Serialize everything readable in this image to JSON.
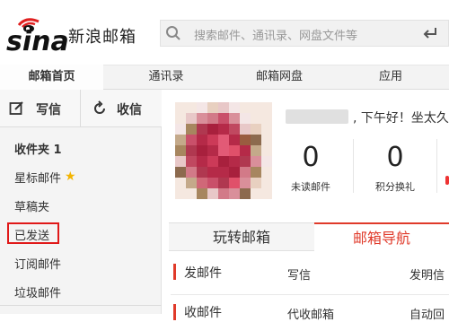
{
  "brand": {
    "logo_text": "sina",
    "name": "新浪邮箱"
  },
  "search": {
    "placeholder": "搜索邮件、通讯录、网盘文件等"
  },
  "nav": {
    "tabs": [
      {
        "label": "邮箱首页",
        "active": true
      },
      {
        "label": "通讯录"
      },
      {
        "label": "邮箱网盘"
      },
      {
        "label": "应用"
      }
    ]
  },
  "sidebar": {
    "compose_label": "写信",
    "receive_label": "收信",
    "items": [
      {
        "label": "收件夹 1"
      },
      {
        "label": "星标邮件",
        "icon": "star-icon"
      },
      {
        "label": "草稿夹"
      },
      {
        "label": "已发送",
        "highlighted": true
      },
      {
        "label": "订阅邮件"
      },
      {
        "label": "垃圾邮件"
      }
    ]
  },
  "profile": {
    "greeting": ", 下午好！坐太久"
  },
  "stats": [
    {
      "value": "0",
      "label": "未读邮件"
    },
    {
      "value": "0",
      "label": "积分换礼"
    }
  ],
  "tabs": {
    "left": "玩转邮箱",
    "right": "邮箱导航"
  },
  "nav_rows": [
    {
      "title": "发邮件",
      "col2": "写信",
      "col3": "发明信"
    },
    {
      "title": "收邮件",
      "col2": "代收邮箱",
      "col3": "自动回"
    }
  ],
  "colors": {
    "accent": "#e03a2a",
    "star": "#f3b400",
    "highlight_border": "#e01818"
  }
}
